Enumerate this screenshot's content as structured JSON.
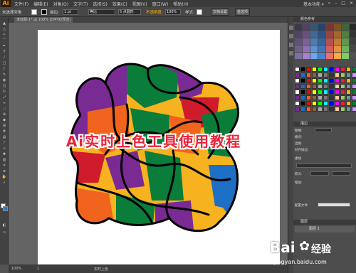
{
  "app": {
    "logo": "Ai"
  },
  "menu": [
    "文件(F)",
    "编辑(E)",
    "对象(O)",
    "文字(T)",
    "选择(S)",
    "效果(C)",
    "视图(V)",
    "窗口(W)",
    "帮助(H)"
  ],
  "top_right": {
    "workspace": "基本功能 ▾",
    "search_icon": "search-icon"
  },
  "control": {
    "selection_label": "未选择对象",
    "stroke_label": "描边:",
    "stroke_value": "1 pt",
    "stroke_style": "等比",
    "brush_value": "5 点圆形",
    "opacity_label": "不透明度:",
    "opacity_value": "100%",
    "style_label": "样式:",
    "doc_setup": "文档设置",
    "prefs": "首选项"
  },
  "doc_tab": {
    "label": "未标题-1* @ 100% (CMYK/预览)"
  },
  "overlay_title": "Ai实时上色工具使用教程",
  "status": {
    "zoom": "100%",
    "page": "1",
    "tool": "实时上色"
  },
  "panels": {
    "swatches_title": "颜色参考",
    "stroke_title": "描边",
    "stroke_weight_label": "粗细:",
    "cap_label": "端点:",
    "corner_label": "边角:",
    "align_label": "对齐描边:",
    "dashed_label": "虚线",
    "arrow_label": "箭头:",
    "scale_label": "缩放:",
    "profile_label": "配置文件:",
    "layers_title": "图层",
    "layer_name": "图层 1"
  },
  "colors": {
    "purple": "#7a2b93",
    "green": "#0b7d3a",
    "orange": "#f0641e",
    "yellow": "#f7b21f",
    "red": "#cf1b2c",
    "blue": "#1d6fc5",
    "overlay_text": "#e8233b"
  },
  "watermark": {
    "brand": "Bai",
    "brand2": "经验",
    "url": "jingyan.baidu.com"
  }
}
